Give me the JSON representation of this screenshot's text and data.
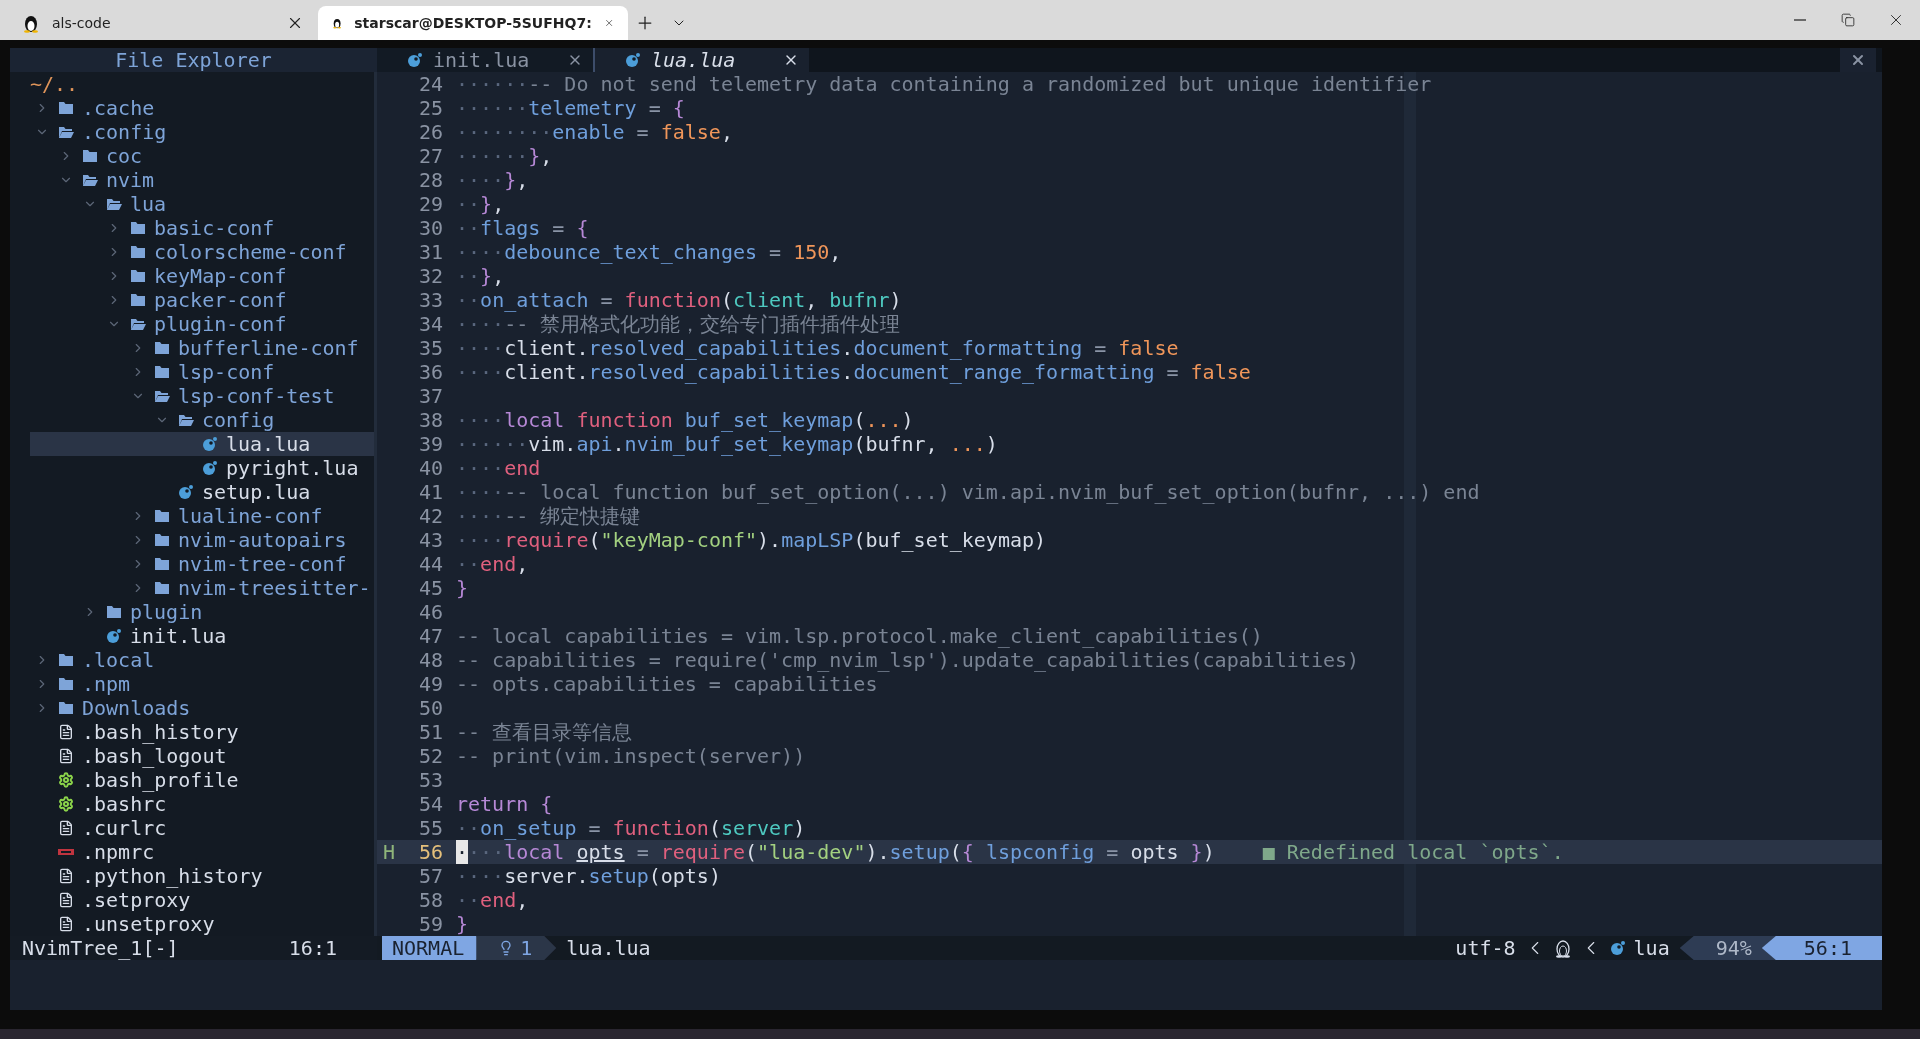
{
  "browser": {
    "tabs": [
      {
        "title": "als-code",
        "selected": false
      },
      {
        "title": "starscar@DESKTOP-5SUFHQ7:",
        "selected": true
      }
    ]
  },
  "sidebar": {
    "title": "File Explorer",
    "root": "~/..",
    "tree": [
      {
        "name": ".cache",
        "kind": "folder",
        "expanded": false,
        "selected": false
      },
      {
        "name": ".config",
        "kind": "folder",
        "expanded": true,
        "selected": false,
        "children": [
          {
            "name": "coc",
            "kind": "folder",
            "expanded": false,
            "selected": false
          },
          {
            "name": "nvim",
            "kind": "folder",
            "expanded": true,
            "selected": false,
            "children": [
              {
                "name": "lua",
                "kind": "folder",
                "expanded": true,
                "selected": false,
                "children": [
                  {
                    "name": "basic-conf",
                    "kind": "folder",
                    "expanded": false,
                    "selected": false
                  },
                  {
                    "name": "colorscheme-conf",
                    "kind": "folder",
                    "expanded": false,
                    "selected": false
                  },
                  {
                    "name": "keyMap-conf",
                    "kind": "folder",
                    "expanded": false,
                    "selected": false
                  },
                  {
                    "name": "packer-conf",
                    "kind": "folder",
                    "expanded": false,
                    "selected": false
                  },
                  {
                    "name": "plugin-conf",
                    "kind": "folder",
                    "expanded": true,
                    "selected": false,
                    "children": [
                      {
                        "name": "bufferline-conf",
                        "kind": "folder",
                        "expanded": false,
                        "selected": false
                      },
                      {
                        "name": "lsp-conf",
                        "kind": "folder",
                        "expanded": false,
                        "selected": false
                      },
                      {
                        "name": "lsp-conf-test",
                        "kind": "folder",
                        "expanded": true,
                        "selected": false,
                        "children": [
                          {
                            "name": "config",
                            "kind": "folder",
                            "expanded": true,
                            "selected": false,
                            "children": [
                              {
                                "name": "lua.lua",
                                "kind": "lua",
                                "selected": true
                              },
                              {
                                "name": "pyright.lua",
                                "kind": "lua",
                                "selected": false
                              }
                            ]
                          },
                          {
                            "name": "setup.lua",
                            "kind": "lua",
                            "selected": false
                          }
                        ]
                      },
                      {
                        "name": "lualine-conf",
                        "kind": "folder",
                        "expanded": false,
                        "selected": false
                      },
                      {
                        "name": "nvim-autopairs",
                        "kind": "folder",
                        "expanded": false,
                        "selected": false
                      },
                      {
                        "name": "nvim-tree-conf",
                        "kind": "folder",
                        "expanded": false,
                        "selected": false
                      },
                      {
                        "name": "nvim-treesitter-",
                        "kind": "folder",
                        "expanded": false,
                        "selected": false
                      }
                    ]
                  }
                ]
              },
              {
                "name": "plugin",
                "kind": "folder",
                "expanded": false,
                "selected": false
              },
              {
                "name": "init.lua",
                "kind": "lua",
                "selected": false
              }
            ]
          }
        ]
      },
      {
        "name": ".local",
        "kind": "folder",
        "expanded": false,
        "selected": false
      },
      {
        "name": ".npm",
        "kind": "folder",
        "expanded": false,
        "selected": false
      },
      {
        "name": "Downloads",
        "kind": "folder",
        "expanded": false,
        "selected": false
      },
      {
        "name": ".bash_history",
        "kind": "text",
        "selected": false
      },
      {
        "name": ".bash_logout",
        "kind": "text",
        "selected": false
      },
      {
        "name": ".bash_profile",
        "kind": "config",
        "selected": false
      },
      {
        "name": ".bashrc",
        "kind": "config",
        "selected": false
      },
      {
        "name": ".curlrc",
        "kind": "text",
        "selected": false
      },
      {
        "name": ".npmrc",
        "kind": "npm",
        "selected": false
      },
      {
        "name": ".python_history",
        "kind": "text",
        "selected": false
      },
      {
        "name": ".setproxy",
        "kind": "text",
        "selected": false
      },
      {
        "name": ".unsetproxy",
        "kind": "text",
        "selected": false
      }
    ]
  },
  "editor": {
    "tabs": [
      {
        "label": "init.lua",
        "selected": false
      },
      {
        "label": "lua.lua",
        "selected": true
      }
    ],
    "lines": [
      {
        "number": "24",
        "current": false,
        "tokens": [
          {
            "text": "······",
            "kind": "ws"
          },
          {
            "text": "-- Do not send telemetry data containing a randomized but unique identifier",
            "kind": "comment"
          }
        ]
      },
      {
        "number": "25",
        "current": false,
        "tokens": [
          {
            "text": "······",
            "kind": "ws"
          },
          {
            "text": "telemetry",
            "kind": "field"
          },
          {
            "text": " = ",
            "kind": "op"
          },
          {
            "text": "{",
            "kind": "brace"
          }
        ]
      },
      {
        "number": "26",
        "current": false,
        "tokens": [
          {
            "text": "········",
            "kind": "ws"
          },
          {
            "text": "enable",
            "kind": "field"
          },
          {
            "text": " = ",
            "kind": "op"
          },
          {
            "text": "false",
            "kind": "const"
          },
          {
            "text": ",",
            "kind": "plain"
          }
        ]
      },
      {
        "number": "27",
        "current": false,
        "tokens": [
          {
            "text": "······",
            "kind": "ws"
          },
          {
            "text": "}",
            "kind": "brace"
          },
          {
            "text": ",",
            "kind": "plain"
          }
        ]
      },
      {
        "number": "28",
        "current": false,
        "tokens": [
          {
            "text": "····",
            "kind": "ws"
          },
          {
            "text": "}",
            "kind": "brace"
          },
          {
            "text": ",",
            "kind": "plain"
          }
        ]
      },
      {
        "number": "29",
        "current": false,
        "tokens": [
          {
            "text": "··",
            "kind": "ws"
          },
          {
            "text": "}",
            "kind": "brace"
          },
          {
            "text": ",",
            "kind": "plain"
          }
        ]
      },
      {
        "number": "30",
        "current": false,
        "tokens": [
          {
            "text": "··",
            "kind": "ws"
          },
          {
            "text": "flags",
            "kind": "field"
          },
          {
            "text": " = ",
            "kind": "op"
          },
          {
            "text": "{",
            "kind": "brace"
          }
        ]
      },
      {
        "number": "31",
        "current": false,
        "tokens": [
          {
            "text": "····",
            "kind": "ws"
          },
          {
            "text": "debounce_text_changes",
            "kind": "field"
          },
          {
            "text": " = ",
            "kind": "op"
          },
          {
            "text": "150",
            "kind": "const"
          },
          {
            "text": ",",
            "kind": "plain"
          }
        ]
      },
      {
        "number": "32",
        "current": false,
        "tokens": [
          {
            "text": "··",
            "kind": "ws"
          },
          {
            "text": "}",
            "kind": "brace"
          },
          {
            "text": ",",
            "kind": "plain"
          }
        ]
      },
      {
        "number": "33",
        "current": false,
        "tokens": [
          {
            "text": "··",
            "kind": "ws"
          },
          {
            "text": "on_attach",
            "kind": "field"
          },
          {
            "text": " = ",
            "kind": "op"
          },
          {
            "text": "function",
            "kind": "fn"
          },
          {
            "text": "(",
            "kind": "plain"
          },
          {
            "text": "client",
            "kind": "param"
          },
          {
            "text": ", ",
            "kind": "plain"
          },
          {
            "text": "bufnr",
            "kind": "param"
          },
          {
            "text": ")",
            "kind": "plain"
          }
        ]
      },
      {
        "number": "34",
        "current": false,
        "tokens": [
          {
            "text": "····",
            "kind": "ws"
          },
          {
            "text": "-- 禁用格式化功能，交给专门插件插件处理",
            "kind": "comment"
          }
        ]
      },
      {
        "number": "35",
        "current": false,
        "tokens": [
          {
            "text": "····",
            "kind": "ws"
          },
          {
            "text": "client.",
            "kind": "plain"
          },
          {
            "text": "resolved_capabilities",
            "kind": "field"
          },
          {
            "text": ".",
            "kind": "plain"
          },
          {
            "text": "document_formatting",
            "kind": "field"
          },
          {
            "text": " = ",
            "kind": "op"
          },
          {
            "text": "false",
            "kind": "const"
          }
        ]
      },
      {
        "number": "36",
        "current": false,
        "tokens": [
          {
            "text": "····",
            "kind": "ws"
          },
          {
            "text": "client.",
            "kind": "plain"
          },
          {
            "text": "resolved_capabilities",
            "kind": "field"
          },
          {
            "text": ".",
            "kind": "plain"
          },
          {
            "text": "document_range_formatting",
            "kind": "field"
          },
          {
            "text": " = ",
            "kind": "op"
          },
          {
            "text": "false",
            "kind": "const"
          }
        ]
      },
      {
        "number": "37",
        "current": false
      },
      {
        "number": "38",
        "current": false,
        "tokens": [
          {
            "text": "····",
            "kind": "ws"
          },
          {
            "text": "local ",
            "kind": "kw"
          },
          {
            "text": "function ",
            "kind": "fn"
          },
          {
            "text": "buf_set_keymap",
            "kind": "field"
          },
          {
            "text": "(",
            "kind": "plain"
          },
          {
            "text": "...",
            "kind": "const"
          },
          {
            "text": ")",
            "kind": "plain"
          }
        ]
      },
      {
        "number": "39",
        "current": false,
        "tokens": [
          {
            "text": "······",
            "kind": "ws"
          },
          {
            "text": "vim.",
            "kind": "plain"
          },
          {
            "text": "api",
            "kind": "field"
          },
          {
            "text": ".",
            "kind": "plain"
          },
          {
            "text": "nvim_buf_set_keymap",
            "kind": "field"
          },
          {
            "text": "(bufnr, ",
            "kind": "plain"
          },
          {
            "text": "...",
            "kind": "const"
          },
          {
            "text": ")",
            "kind": "plain"
          }
        ]
      },
      {
        "number": "40",
        "current": false,
        "tokens": [
          {
            "text": "····",
            "kind": "ws"
          },
          {
            "text": "end",
            "kind": "fn"
          }
        ]
      },
      {
        "number": "41",
        "current": false,
        "tokens": [
          {
            "text": "····",
            "kind": "ws"
          },
          {
            "text": "-- local function buf_set_option(...) vim.api.nvim_buf_set_option(bufnr, ...) end",
            "kind": "comment"
          }
        ]
      },
      {
        "number": "42",
        "current": false,
        "tokens": [
          {
            "text": "····",
            "kind": "ws"
          },
          {
            "text": "-- 绑定快捷键",
            "kind": "comment"
          }
        ]
      },
      {
        "number": "43",
        "current": false,
        "tokens": [
          {
            "text": "····",
            "kind": "ws"
          },
          {
            "text": "require",
            "kind": "fn"
          },
          {
            "text": "(",
            "kind": "plain"
          },
          {
            "text": "\"keyMap-conf\"",
            "kind": "string"
          },
          {
            "text": ").",
            "kind": "plain"
          },
          {
            "text": "mapLSP",
            "kind": "field"
          },
          {
            "text": "(buf_set_keymap)",
            "kind": "plain"
          }
        ]
      },
      {
        "number": "44",
        "current": false,
        "tokens": [
          {
            "text": "··",
            "kind": "ws"
          },
          {
            "text": "end",
            "kind": "fn"
          },
          {
            "text": ",",
            "kind": "plain"
          }
        ]
      },
      {
        "number": "45",
        "current": false,
        "tokens": [
          {
            "text": "}",
            "kind": "brace"
          }
        ]
      },
      {
        "number": "46",
        "current": false
      },
      {
        "number": "47",
        "current": false,
        "tokens": [
          {
            "text": "-- local capabilities = vim.lsp.protocol.make_client_capabilities()",
            "kind": "comment"
          }
        ]
      },
      {
        "number": "48",
        "current": false,
        "tokens": [
          {
            "text": "-- capabilities = require('cmp_nvim_lsp').update_capabilities(capabilities)",
            "kind": "comment"
          }
        ]
      },
      {
        "number": "49",
        "current": false,
        "tokens": [
          {
            "text": "-- opts.capabilities = capabilities",
            "kind": "comment"
          }
        ]
      },
      {
        "number": "50",
        "current": false
      },
      {
        "number": "51",
        "current": false,
        "tokens": [
          {
            "text": "-- 查看目录等信息",
            "kind": "comment"
          }
        ]
      },
      {
        "number": "52",
        "current": false,
        "tokens": [
          {
            "text": "-- print(vim.inspect(server))",
            "kind": "comment"
          }
        ]
      },
      {
        "number": "53",
        "current": false
      },
      {
        "number": "54",
        "current": false,
        "tokens": [
          {
            "text": "return ",
            "kind": "kw"
          },
          {
            "text": "{",
            "kind": "brace"
          }
        ]
      },
      {
        "number": "55",
        "current": false,
        "tokens": [
          {
            "text": "··",
            "kind": "ws"
          },
          {
            "text": "on_setup",
            "kind": "field"
          },
          {
            "text": " = ",
            "kind": "op"
          },
          {
            "text": "function",
            "kind": "fn"
          },
          {
            "text": "(",
            "kind": "plain"
          },
          {
            "text": "server",
            "kind": "param"
          },
          {
            "text": ")",
            "kind": "plain"
          }
        ]
      },
      {
        "number": "56",
        "current": true,
        "sign": "H",
        "diagnostic": "■ Redefined local `opts`.",
        "tokens": [
          {
            "text": "·",
            "kind": "cursor"
          },
          {
            "text": "···",
            "kind": "ws"
          },
          {
            "text": "local ",
            "kind": "kw"
          },
          {
            "text": "opts",
            "kind": "underline"
          },
          {
            "text": " = ",
            "kind": "op"
          },
          {
            "text": "require",
            "kind": "fn"
          },
          {
            "text": "(",
            "kind": "plain"
          },
          {
            "text": "\"lua-dev\"",
            "kind": "string"
          },
          {
            "text": ").",
            "kind": "plain"
          },
          {
            "text": "setup",
            "kind": "field"
          },
          {
            "text": "(",
            "kind": "plain"
          },
          {
            "text": "{ ",
            "kind": "brace"
          },
          {
            "text": "lspconfig",
            "kind": "field"
          },
          {
            "text": " = ",
            "kind": "op"
          },
          {
            "text": "opts ",
            "kind": "plain"
          },
          {
            "text": "}",
            "kind": "brace"
          },
          {
            "text": ")",
            "kind": "plain"
          }
        ]
      },
      {
        "number": "57",
        "current": false,
        "tokens": [
          {
            "text": "····",
            "kind": "ws"
          },
          {
            "text": "server.",
            "kind": "plain"
          },
          {
            "text": "setup",
            "kind": "field"
          },
          {
            "text": "(opts)",
            "kind": "plain"
          }
        ]
      },
      {
        "number": "58",
        "current": false,
        "tokens": [
          {
            "text": "··",
            "kind": "ws"
          },
          {
            "text": "end",
            "kind": "fn"
          },
          {
            "text": ",",
            "kind": "plain"
          }
        ]
      },
      {
        "number": "59",
        "current": false,
        "tokens": [
          {
            "text": "}",
            "kind": "brace"
          }
        ]
      }
    ]
  },
  "statusline": {
    "sidebar_name": "NvimTree_1[-]",
    "sidebar_position": "16:1",
    "mode": "NORMAL",
    "diagnostics": "1",
    "filename": "lua.lua",
    "encoding": "utf-8",
    "filetype": "lua",
    "progress": "94%",
    "position": "56:1"
  }
}
